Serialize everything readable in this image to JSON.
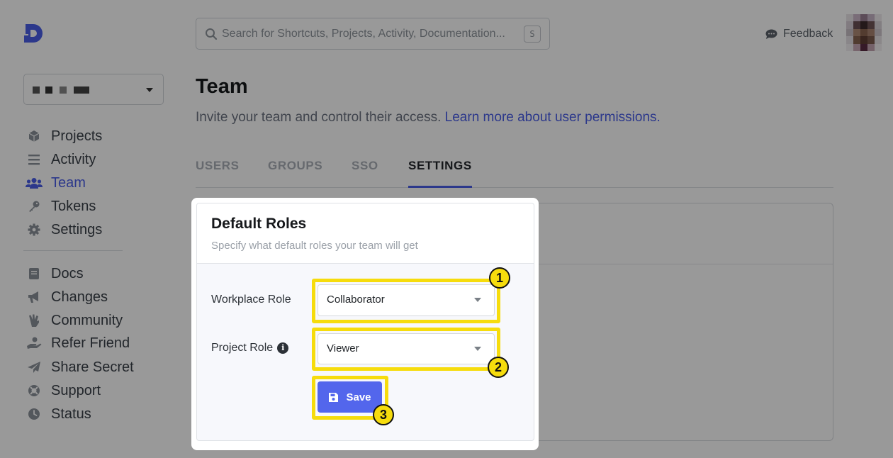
{
  "search": {
    "placeholder": "Search for Shortcuts, Projects, Activity, Documentation...",
    "shortcut": "S"
  },
  "header": {
    "feedback_label": "Feedback"
  },
  "sidebar": {
    "primary": [
      {
        "label": "Projects",
        "icon": "cube-icon"
      },
      {
        "label": "Activity",
        "icon": "list-icon"
      },
      {
        "label": "Team",
        "icon": "users-icon",
        "active": true
      },
      {
        "label": "Tokens",
        "icon": "key-icon"
      },
      {
        "label": "Settings",
        "icon": "gear-icon"
      }
    ],
    "secondary": [
      {
        "label": "Docs",
        "icon": "book-icon"
      },
      {
        "label": "Changes",
        "icon": "megaphone-icon"
      },
      {
        "label": "Community",
        "icon": "hand-icon"
      },
      {
        "label": "Refer Friend",
        "icon": "hand-holding-icon"
      },
      {
        "label": "Share Secret",
        "icon": "paper-plane-icon"
      },
      {
        "label": "Support",
        "icon": "life-ring-icon"
      },
      {
        "label": "Status",
        "icon": "clock-icon"
      }
    ]
  },
  "page": {
    "title": "Team",
    "subtitle_text": "Invite your team and control their access. ",
    "subtitle_link": "Learn more about user permissions.",
    "tabs": [
      {
        "label": "USERS",
        "active": false
      },
      {
        "label": "GROUPS",
        "active": false
      },
      {
        "label": "SSO",
        "active": false
      },
      {
        "label": "SETTINGS",
        "active": true
      }
    ]
  },
  "panel": {
    "title": "Default Roles",
    "subtitle": "Specify what default roles your team will get",
    "workplace_role_label": "Workplace Role",
    "workplace_role_value": "Collaborator",
    "project_role_label": "Project Role",
    "project_role_value": "Viewer",
    "save_label": "Save"
  },
  "annotations": {
    "step1": "1",
    "step2": "2",
    "step3": "3"
  },
  "colors": {
    "accent": "#4a5ee8",
    "button": "#5366ec",
    "highlight": "#f6dc0d"
  }
}
